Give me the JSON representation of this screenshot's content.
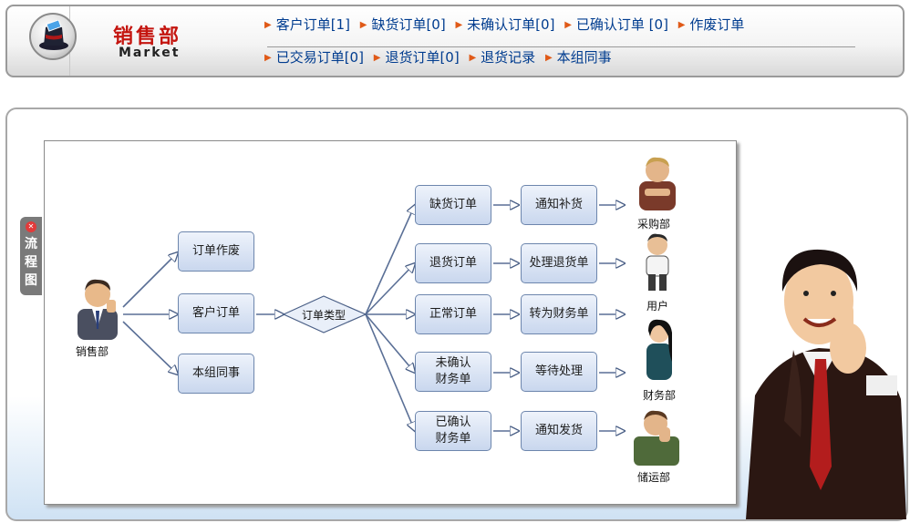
{
  "header": {
    "title": "销售部",
    "subtitle": "Market",
    "menu_row1": [
      {
        "label": "客户订单[1]"
      },
      {
        "label": "缺货订单[0]"
      },
      {
        "label": "未确认订单[0]"
      },
      {
        "label": "已确认订单 [0]"
      },
      {
        "label": "作废订单"
      }
    ],
    "menu_row2": [
      {
        "label": "已交易订单[0]"
      },
      {
        "label": "退货订单[0]"
      },
      {
        "label": "退货记录"
      },
      {
        "label": "本组同事"
      }
    ]
  },
  "side_tab": {
    "label": "流程图"
  },
  "flow": {
    "sales_label": "销售部",
    "level1": {
      "void": "订单作废",
      "customer": "客户订单",
      "colleague": "本组同事"
    },
    "decision": "订单类型",
    "types": {
      "shortage": "缺货订单",
      "return": "退货订单",
      "normal": "正常订单",
      "unconfirmed_l1": "未确认",
      "unconfirmed_l2": "财务单",
      "confirmed_l1": "已确认",
      "confirmed_l2": "财务单"
    },
    "actions": {
      "restock": "通知补货",
      "process_return": "处理退货单",
      "to_finance": "转为财务单",
      "wait": "等待处理",
      "ship": "通知发货"
    },
    "roles": {
      "purchasing": "采购部",
      "user": "用户",
      "finance": "财务部",
      "logistics": "储运部"
    }
  }
}
